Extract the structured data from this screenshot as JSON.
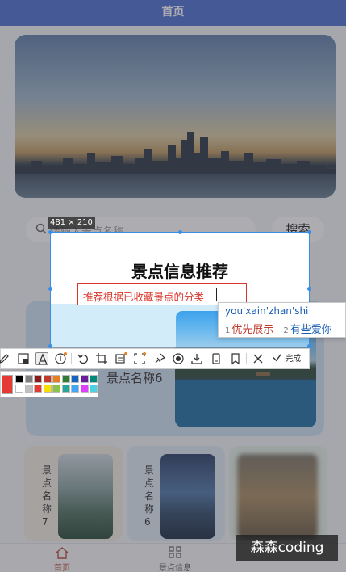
{
  "app": {
    "nav_title": "首页",
    "search": {
      "placeholder": "请输入景点名称",
      "button_label": "搜索"
    },
    "section_text": "景点名称6",
    "cards": [
      {
        "title": "景点名称7"
      },
      {
        "title": "景点名称6"
      },
      {
        "title": ""
      }
    ],
    "tabbar": [
      {
        "label": "首页",
        "icon": "home-icon",
        "active": true
      },
      {
        "label": "景点信息",
        "icon": "grid-icon",
        "active": false
      }
    ]
  },
  "overlay": {
    "selection_size": "481 × 210",
    "title": "景点信息推荐",
    "text_input_value": "推荐根据已收藏景点的分类",
    "ime": {
      "pinyin": "you'xain'zhan'shi",
      "candidates": [
        {
          "index": "1",
          "text": "优先展示"
        },
        {
          "index": "2",
          "text": "有些爱你"
        }
      ]
    },
    "toolbar": {
      "tools": [
        "pencil-icon",
        "mosaic-icon",
        "text-icon",
        "number-marker-icon",
        "undo-icon",
        "crop-icon",
        "ocr-icon",
        "scan-icon",
        "pin-icon",
        "record-icon",
        "download-icon",
        "save-icon",
        "bookmark-icon",
        "close-icon",
        "check-icon"
      ],
      "done_label": "完成"
    },
    "palette": {
      "current": "#e53935",
      "colors": [
        "#000000",
        "#808080",
        "#8b1a1a",
        "#c0392b",
        "#e67e22",
        "#2e7d32",
        "#1565c0",
        "#6a1b9a",
        "#00897b",
        "#ffffff",
        "#c0c0c0",
        "#e53935",
        "#f6e000",
        "#8bc34a",
        "#26a69a",
        "#42a5f5",
        "#e040fb",
        "#4dd0e1"
      ]
    }
  },
  "watermark": "森森coding"
}
